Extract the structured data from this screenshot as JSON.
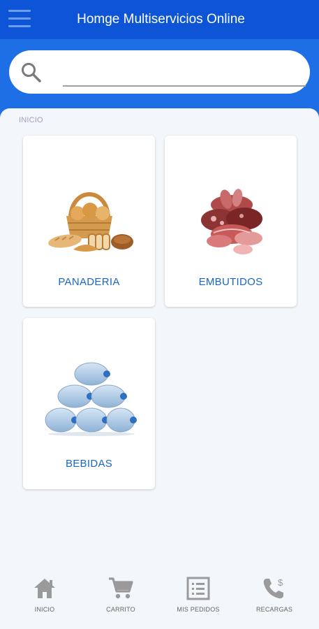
{
  "header": {
    "title": "Homge Multiservicios Online",
    "menu_icon": "hamburger-menu-icon"
  },
  "search": {
    "placeholder": "",
    "value": "",
    "icon": "search-icon"
  },
  "breadcrumb": "INICIO",
  "categories": [
    {
      "label": "PANADERIA",
      "image": "bread-basket-image"
    },
    {
      "label": "EMBUTIDOS",
      "image": "cold-cuts-image"
    },
    {
      "label": "BEBIDAS",
      "image": "water-jugs-image"
    }
  ],
  "bottom_nav": [
    {
      "label": "INICIO",
      "icon": "home-icon"
    },
    {
      "label": "CARRITO",
      "icon": "cart-icon"
    },
    {
      "label": "MIS PEDIDOS",
      "icon": "list-icon"
    },
    {
      "label": "RECARGAS",
      "icon": "phone-dollar-icon"
    }
  ],
  "colors": {
    "primary": "#0d55d6",
    "search_band": "#1e6fe6",
    "category_label": "#1a66c4",
    "background": "#f3f6fa"
  }
}
